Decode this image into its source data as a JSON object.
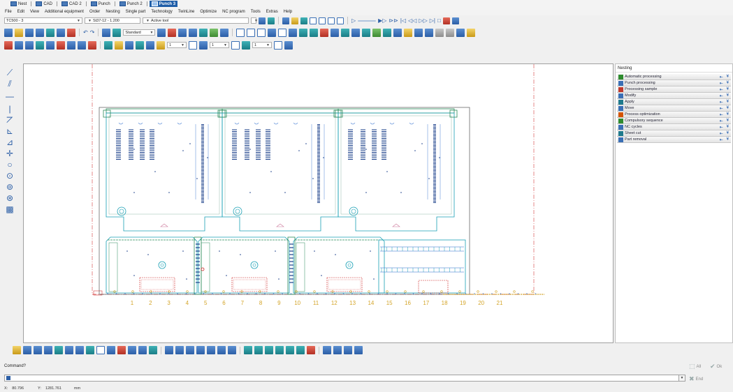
{
  "tabs": [
    {
      "label": "Nest",
      "active": false
    },
    {
      "label": "CAD",
      "active": false
    },
    {
      "label": "CAD 2",
      "active": false
    },
    {
      "label": "Punch",
      "active": false
    },
    {
      "label": "Punch 2",
      "active": false
    },
    {
      "label": "Punch 3",
      "active": true
    }
  ],
  "menu": [
    "File",
    "Edit",
    "View",
    "Additional equipment",
    "Order",
    "Nesting",
    "Single part",
    "Technology",
    "TwinLine",
    "Optimize",
    "NC program",
    "Tools",
    "Extras",
    "Help"
  ],
  "toolbar": {
    "machine_combo": "TC500 - 3",
    "material_combo": "St37-12 - 1.200",
    "tool_combo": "Active tool",
    "standard_combo": "Standard",
    "small_combo_1": "1",
    "small_combo_2": "1",
    "small_combo_3": "1"
  },
  "canvas": {
    "ruler_labels": [
      "1",
      "2",
      "3",
      "4",
      "5",
      "6",
      "7",
      "8",
      "9",
      "10",
      "11",
      "12",
      "13",
      "14",
      "15",
      "16",
      "17",
      "18",
      "19",
      "20",
      "21"
    ]
  },
  "right_panel": {
    "title": "Nesting",
    "items": [
      {
        "label": "Automatic processing",
        "icon": "play-icon",
        "color": "#2e8b2e"
      },
      {
        "label": "Punch processing",
        "icon": "punch-icon",
        "color": "#3a6fb5"
      },
      {
        "label": "Processing sample",
        "icon": "sample-icon",
        "color": "#c0392b"
      },
      {
        "label": "Modify",
        "icon": "modify-icon",
        "color": "#3a6fb5"
      },
      {
        "label": "Apply",
        "icon": "apply-icon",
        "color": "#1f7a8c"
      },
      {
        "label": "Move",
        "icon": "move-icon",
        "color": "#3a6fb5"
      },
      {
        "label": "Process optimization",
        "icon": "optimize-icon",
        "color": "#d35400"
      },
      {
        "label": "Compulsory sequence",
        "icon": "sequence-icon",
        "color": "#2e8b2e"
      },
      {
        "label": "NC cycles",
        "icon": "nc-cycles-icon",
        "color": "#3a6fb5"
      },
      {
        "label": "Sheet cut",
        "icon": "sheet-cut-icon",
        "color": "#1f7a8c"
      },
      {
        "label": "Part removal",
        "icon": "part-removal-icon",
        "color": "#3a6fb5"
      }
    ]
  },
  "command": {
    "label": "Command?",
    "value": "",
    "all_label": "All",
    "ok_label": "Ok",
    "end_label": "End"
  },
  "status": {
    "x_label": "X:",
    "x_value": "80.796",
    "y_label": "Y:",
    "y_value": "1281.761",
    "unit": "mm"
  }
}
